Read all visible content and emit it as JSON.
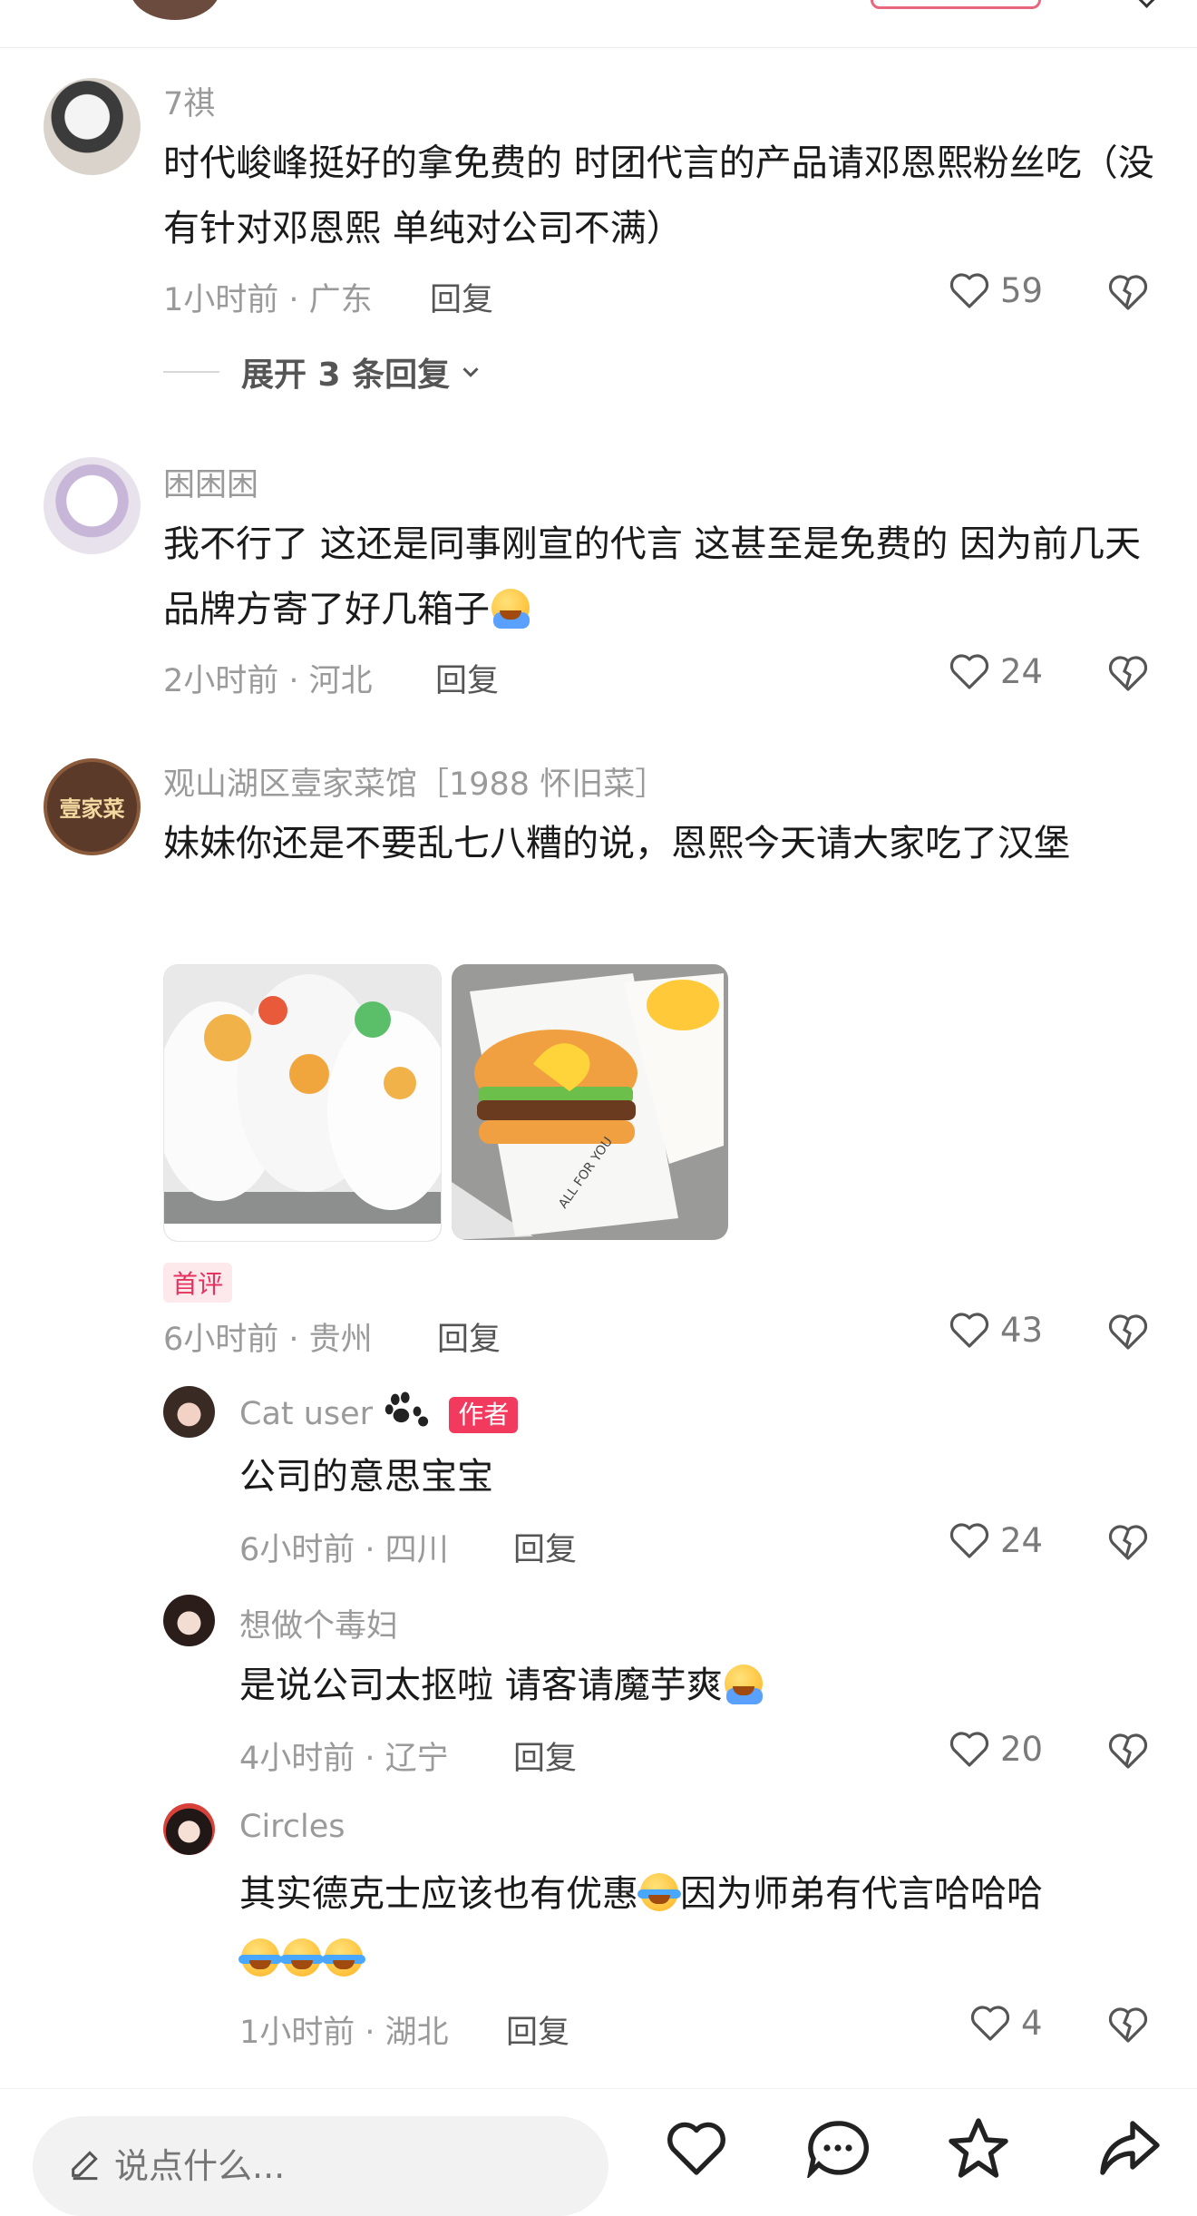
{
  "comments": [
    {
      "username": "7祺",
      "text": "时代峻峰挺好的拿免费的 时团代言的产品请邓恩熙粉丝吃（没有针对邓恩熙 单纯对公司不满）",
      "time": "1小时前",
      "location": "广东",
      "reply_label": "回复",
      "likes": "59",
      "expand_label": "展开 3 条回复"
    },
    {
      "username": "困困困",
      "text": "我不行了 这还是同事刚宣的代言 这甚至是免费的 因为前几天品牌方寄了好几箱子",
      "time": "2小时前",
      "location": "河北",
      "reply_label": "回复",
      "likes": "24"
    },
    {
      "username": "观山湖区壹家菜馆［1988 怀旧菜］",
      "avatar_text": "壹家菜",
      "text": "妹妹你还是不要乱七八糟的说，恩熙今天请大家吃了汉堡",
      "badge": "首评",
      "time": "6小时前",
      "location": "贵州",
      "reply_label": "回复",
      "likes": "43",
      "photo2_text": "ALL FOR YOU",
      "replies": [
        {
          "username": "Cat user",
          "author_badge": "作者",
          "text": "公司的意思宝宝",
          "time": "6小时前",
          "location": "四川",
          "reply_label": "回复",
          "likes": "24"
        },
        {
          "username": "想做个毒妇",
          "text": "是说公司太抠啦 请客请魔芋爽",
          "time": "4小时前",
          "location": "辽宁",
          "reply_label": "回复",
          "likes": "20"
        },
        {
          "username": "Circles",
          "text_a": "其实德克士应该也有优惠",
          "text_b": "因为师弟有代言哈哈哈",
          "time": "1小时前",
          "location": "湖北",
          "reply_label": "回复",
          "likes": "4"
        }
      ]
    }
  ],
  "bottom_bar": {
    "input_placeholder": "说点什么..."
  },
  "icons": [
    "heart-icon",
    "dislike-heart-icon",
    "chevron-down-icon",
    "pencil-icon",
    "chat-icon",
    "star-icon",
    "share-icon",
    "paw-icon"
  ],
  "colors": {
    "accent": "#f23a5e",
    "meta": "#9a9a9a"
  }
}
